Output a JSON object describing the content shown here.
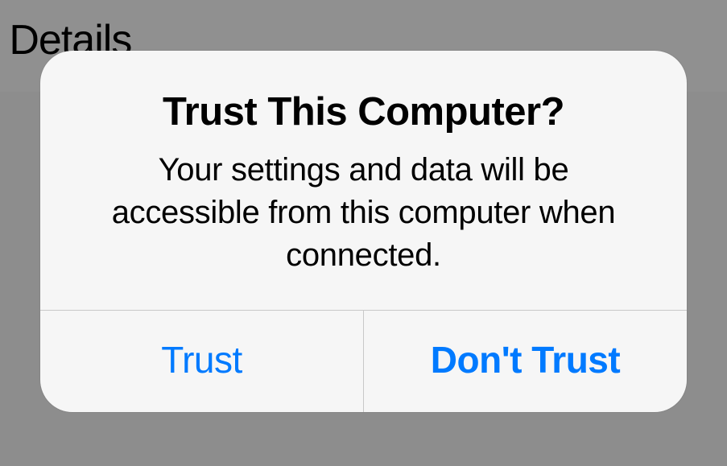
{
  "background": {
    "partial_text": "e Details"
  },
  "dialog": {
    "title": "Trust This Computer?",
    "message": "Your settings and data will be accessible from this computer when connected.",
    "buttons": {
      "trust": "Trust",
      "dont_trust": "Don't Trust"
    }
  }
}
